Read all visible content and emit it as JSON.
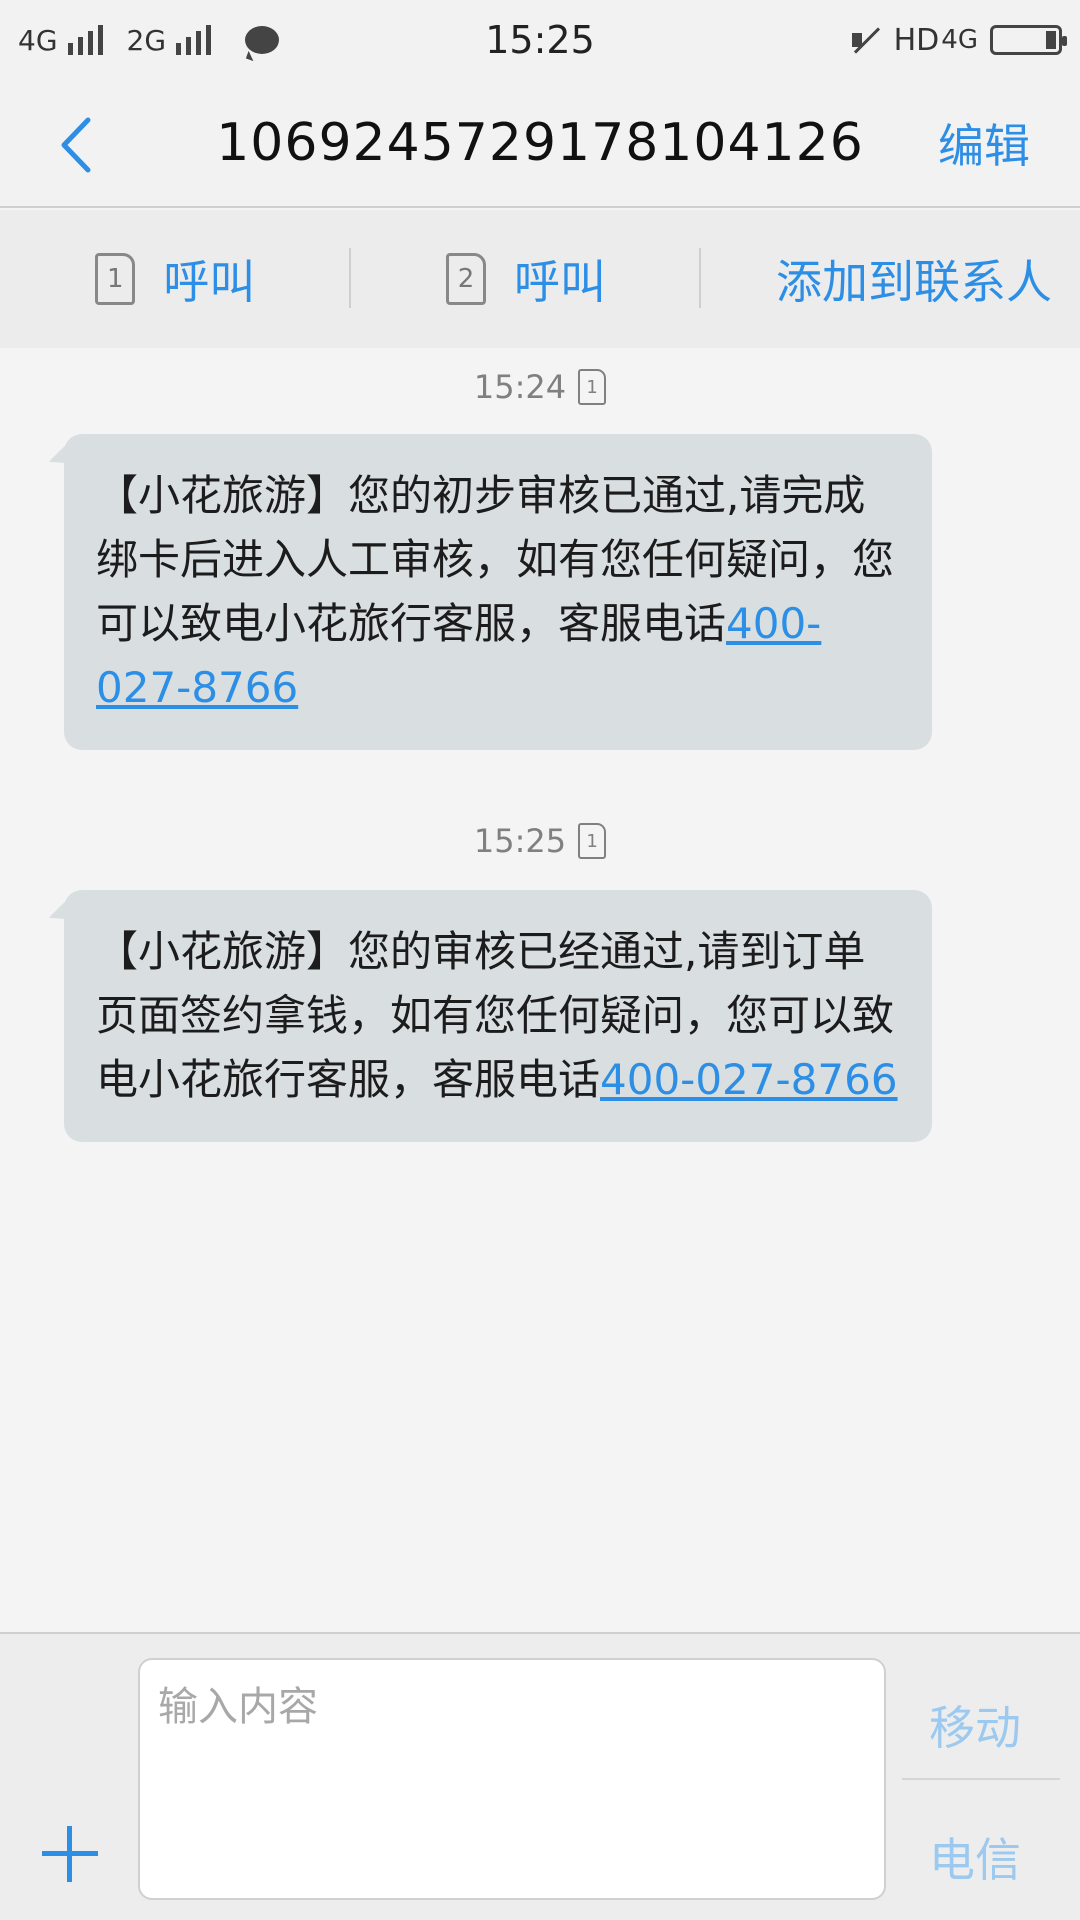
{
  "status_bar": {
    "net1": "4G",
    "net2": "2G",
    "time": "15:25",
    "hd": "HD",
    "net3": "4G"
  },
  "header": {
    "title": "1069245729178104126",
    "edit_label": "编辑"
  },
  "actions": {
    "call1": {
      "sim": "1",
      "label": "呼叫"
    },
    "call2": {
      "sim": "2",
      "label": "呼叫"
    },
    "add_contact": "添加到联系人"
  },
  "messages": [
    {
      "time": "15:24",
      "sim": "1",
      "text": "【小花旅游】您的初步审核已通过,请完成绑卡后进入人工审核，如有您任何疑问，您可以致电小花旅行客服，客服电话",
      "phone": "400-027-8766"
    },
    {
      "time": "15:25",
      "sim": "1",
      "text": "【小花旅游】您的审核已经通过,请到订单页面签约拿钱，如有您任何疑问，您可以致电小花旅行客服，客服电话",
      "phone": "400-027-8766"
    }
  ],
  "compose": {
    "placeholder": "输入内容",
    "send_sim1": "移动",
    "send_sim2": "电信"
  },
  "colors": {
    "accent": "#2d8ee6",
    "bubble": "#d9dfe1",
    "background": "#f4f4f4"
  }
}
